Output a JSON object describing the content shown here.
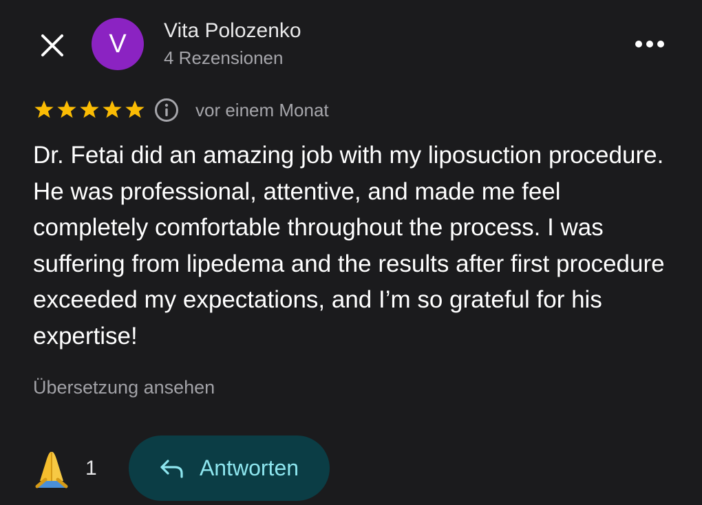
{
  "header": {
    "avatar_letter": "V",
    "avatar_color": "#8b23c2",
    "author_name": "Vita Polozenko",
    "review_count": "4 Rezensionen",
    "close_icon": "close-icon",
    "more_icon": "more-horizontal-icon"
  },
  "review": {
    "rating": 5,
    "max_rating": 5,
    "star_color": "#fbbc04",
    "date": "vor einem Monat",
    "text": "Dr. Fetai did an amazing job with my liposuction procedure. He was professional, attentive, and made me feel completely comfortable throughout the process. I was suffering from lipedema and the results after first procedure exceeded my expectations, and I’m so grateful for his expertise!",
    "translate_label": "Übersetzung ansehen"
  },
  "actions": {
    "reaction_icon": "folded-hands-icon",
    "reaction_count": "1",
    "reply_label": "Antworten",
    "reply_color": "#8ee6ef",
    "reply_background": "#0b3d45"
  }
}
